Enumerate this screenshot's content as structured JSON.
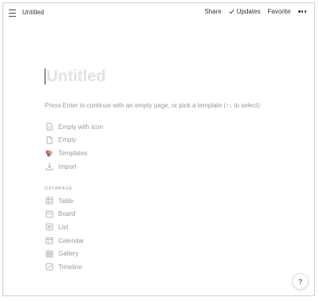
{
  "topbar": {
    "page_title": "Untitled",
    "share_label": "Share",
    "updates_label": "Updates",
    "favorite_label": "Favorite"
  },
  "page": {
    "title_placeholder": "Untitled",
    "hint": "Press Enter to continue with an empty page, or pick a template (↑↓ to select)"
  },
  "options": [
    {
      "label": "Empty with icon",
      "icon": "page-with-icon-icon"
    },
    {
      "label": "Empty",
      "icon": "page-icon"
    },
    {
      "label": "Templates",
      "icon": "templates-icon"
    },
    {
      "label": "Import",
      "icon": "import-icon"
    }
  ],
  "database": {
    "section_label": "DATABASE",
    "items": [
      {
        "label": "Table",
        "icon": "table-icon"
      },
      {
        "label": "Board",
        "icon": "board-icon"
      },
      {
        "label": "List",
        "icon": "list-icon"
      },
      {
        "label": "Calendar",
        "icon": "calendar-icon"
      },
      {
        "label": "Gallery",
        "icon": "gallery-icon"
      },
      {
        "label": "Timeline",
        "icon": "timeline-icon"
      }
    ]
  },
  "help": {
    "label": "?"
  },
  "colors": {
    "text": "#37352f",
    "muted": "#9b9a97",
    "placeholder": "#e3e2e0"
  }
}
